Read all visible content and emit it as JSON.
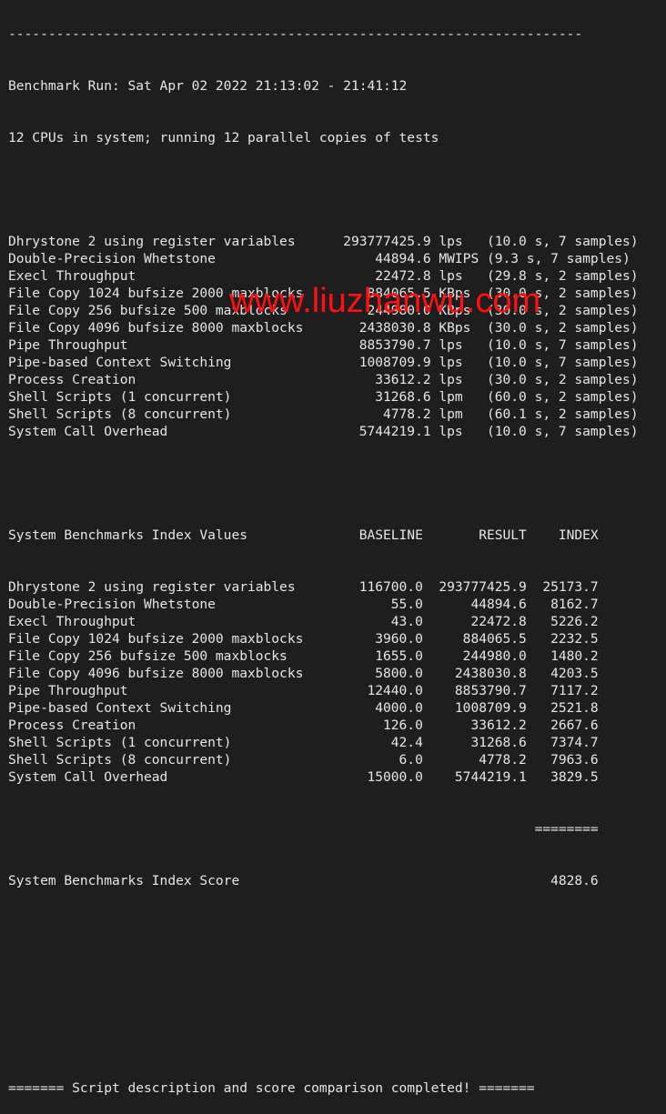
{
  "terminal": {
    "separator": "------------------------------------------------------------------------",
    "run_header": "Benchmark Run: Sat Apr 02 2022 21:13:02 - 21:41:12",
    "cpu_info": "12 CPUs in system; running 12 parallel copies of tests",
    "raw_results": [
      {
        "name": "Dhrystone 2 using register variables",
        "value": "293777425.9",
        "unit": "lps",
        "detail": "(10.0 s, 7 samples)"
      },
      {
        "name": "Double-Precision Whetstone",
        "value": "44894.6",
        "unit": "MWIPS",
        "detail": "(9.3 s, 7 samples)"
      },
      {
        "name": "Execl Throughput",
        "value": "22472.8",
        "unit": "lps",
        "detail": "(29.8 s, 2 samples)"
      },
      {
        "name": "File Copy 1024 bufsize 2000 maxblocks",
        "value": "884065.5",
        "unit": "KBps",
        "detail": "(30.0 s, 2 samples)"
      },
      {
        "name": "File Copy 256 bufsize 500 maxblocks",
        "value": "244980.0",
        "unit": "KBps",
        "detail": "(30.0 s, 2 samples)"
      },
      {
        "name": "File Copy 4096 bufsize 8000 maxblocks",
        "value": "2438030.8",
        "unit": "KBps",
        "detail": "(30.0 s, 2 samples)"
      },
      {
        "name": "Pipe Throughput",
        "value": "8853790.7",
        "unit": "lps",
        "detail": "(10.0 s, 7 samples)"
      },
      {
        "name": "Pipe-based Context Switching",
        "value": "1008709.9",
        "unit": "lps",
        "detail": "(10.0 s, 7 samples)"
      },
      {
        "name": "Process Creation",
        "value": "33612.2",
        "unit": "lps",
        "detail": "(30.0 s, 2 samples)"
      },
      {
        "name": "Shell Scripts (1 concurrent)",
        "value": "31268.6",
        "unit": "lpm",
        "detail": "(60.0 s, 2 samples)"
      },
      {
        "name": "Shell Scripts (8 concurrent)",
        "value": "4778.2",
        "unit": "lpm",
        "detail": "(60.1 s, 2 samples)"
      },
      {
        "name": "System Call Overhead",
        "value": "5744219.1",
        "unit": "lps",
        "detail": "(10.0 s, 7 samples)"
      }
    ],
    "index_table": {
      "title": "System Benchmarks Index Values",
      "headers": [
        "BASELINE",
        "RESULT",
        "INDEX"
      ],
      "rows": [
        {
          "name": "Dhrystone 2 using register variables",
          "baseline": "116700.0",
          "result": "293777425.9",
          "index": "25173.7"
        },
        {
          "name": "Double-Precision Whetstone",
          "baseline": "55.0",
          "result": "44894.6",
          "index": "8162.7"
        },
        {
          "name": "Execl Throughput",
          "baseline": "43.0",
          "result": "22472.8",
          "index": "5226.2"
        },
        {
          "name": "File Copy 1024 bufsize 2000 maxblocks",
          "baseline": "3960.0",
          "result": "884065.5",
          "index": "2232.5"
        },
        {
          "name": "File Copy 256 bufsize 500 maxblocks",
          "baseline": "1655.0",
          "result": "244980.0",
          "index": "1480.2"
        },
        {
          "name": "File Copy 4096 bufsize 8000 maxblocks",
          "baseline": "5800.0",
          "result": "2438030.8",
          "index": "4203.5"
        },
        {
          "name": "Pipe Throughput",
          "baseline": "12440.0",
          "result": "8853790.7",
          "index": "7117.2"
        },
        {
          "name": "Pipe-based Context Switching",
          "baseline": "4000.0",
          "result": "1008709.9",
          "index": "2521.8"
        },
        {
          "name": "Process Creation",
          "baseline": "126.0",
          "result": "33612.2",
          "index": "2667.6"
        },
        {
          "name": "Shell Scripts (1 concurrent)",
          "baseline": "42.4",
          "result": "31268.6",
          "index": "7374.7"
        },
        {
          "name": "Shell Scripts (8 concurrent)",
          "baseline": "6.0",
          "result": "4778.2",
          "index": "7963.6"
        },
        {
          "name": "System Call Overhead",
          "baseline": "15000.0",
          "result": "5744219.1",
          "index": "3829.5"
        }
      ],
      "score_separator": "========",
      "score_label": "System Benchmarks Index Score",
      "score_value": "4828.6"
    },
    "footer": "======= Script description and score comparison completed! ======="
  },
  "watermark": "www.liuzhanwu.com",
  "colors": {
    "background": "#1e1e1e",
    "text": "#e6e6e6",
    "watermark": "#ff1010"
  }
}
